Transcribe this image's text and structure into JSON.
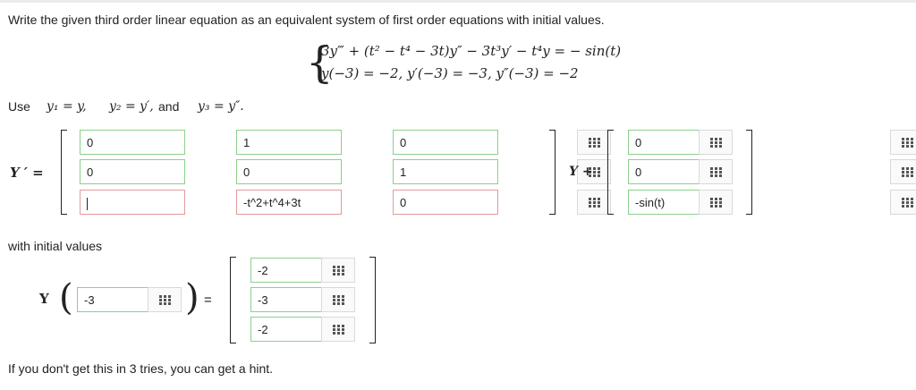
{
  "problem": {
    "statement": "Write the given third order linear equation as an equivalent system of first order equations with initial values.",
    "equation_line1": "3y‴ + (t² − t⁴ − 3t)y″ − 3t³y′ − t⁴y = − sin(t)",
    "equation_line2": "y(−3) = −2,   y′(−3) = −3,   y″(−3) = −2"
  },
  "use_line": {
    "use": "Use",
    "y1": "y₁ = y,",
    "y2": "y₂ = y′,",
    "and": "and",
    "y3": "y₃ = y″."
  },
  "system": {
    "lhs": "Y ′ =",
    "matrix": [
      [
        "0",
        "1",
        "0"
      ],
      [
        "0",
        "0",
        "1"
      ],
      [
        "",
        "-t^2+t^4+3t",
        "0"
      ]
    ],
    "y_plus": "Y +",
    "forcing": [
      "0",
      "0",
      "-sin(t)"
    ]
  },
  "initial": {
    "label": "with initial values",
    "y_label": "Y",
    "arg": "-3",
    "equals": "=",
    "values": [
      "-2",
      "-3",
      "-2"
    ]
  },
  "hint_text": "If you don't get this in 3 tries, you can get a hint.",
  "colors": {
    "correct_border": "#8ccf8c",
    "wrong_border": "#e49a9a"
  },
  "icons": {
    "matrix_palette": "grid-icon"
  }
}
